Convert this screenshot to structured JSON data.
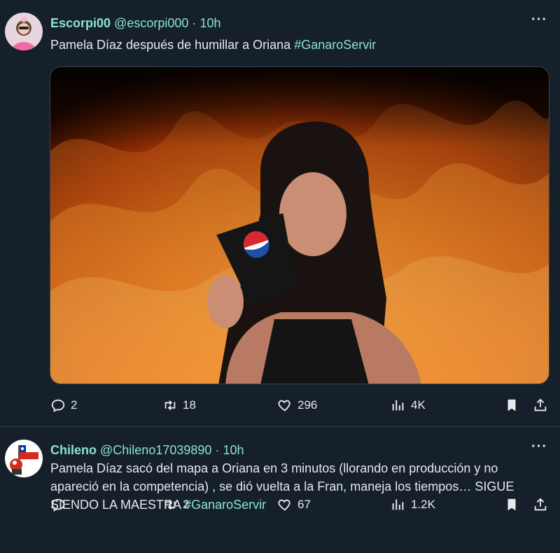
{
  "tweets": [
    {
      "author": {
        "display_name": "Escorpi00",
        "handle": "@escorpi000",
        "separator": "·",
        "time": "10h",
        "avatar_icon": "avatar-pink-girl"
      },
      "text_plain": "Pamela Díaz después de humillar a Oriana ",
      "hashtag": "#GanaroServir",
      "media": {
        "description_icon": "fire-photo",
        "cup_brand": "pepsi"
      },
      "stats": {
        "replies": "2",
        "retweets": "18",
        "likes": "296",
        "views": "4K"
      }
    },
    {
      "author": {
        "display_name": "Chileno",
        "handle": "@Chileno17039890",
        "separator": "·",
        "time": "10h",
        "avatar_icon": "avatar-chile-flag"
      },
      "text_plain": "Pamela Díaz sacó del mapa a Oriana en 3 minutos (llorando en producción y no apareció en la competencia) , se dió vuelta a la Fran, maneja los tiempos… SIGUE SIENDO LA MAESTRA ",
      "hashtag": "#GanaroServir",
      "stats": {
        "replies": "",
        "retweets": "2",
        "likes": "67",
        "views": "1.2K"
      }
    }
  ],
  "more_label": "···",
  "colors": {
    "background": "#15202b",
    "accent": "#8be3d0",
    "text": "#e7e9ea",
    "divider": "#38444d"
  }
}
